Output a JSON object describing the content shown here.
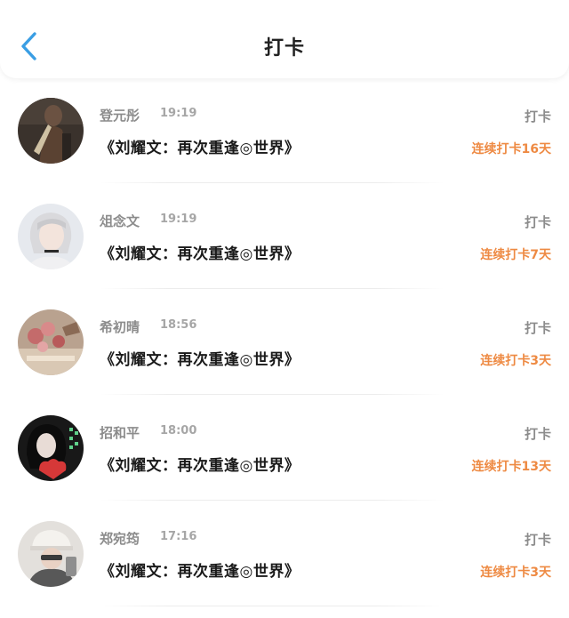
{
  "header": {
    "title": "打卡",
    "back_icon": "chevron-left-icon",
    "accent_color": "#3a9ee4"
  },
  "checkin_label": "打卡",
  "entries": [
    {
      "name": "登元彤",
      "time": "19:19",
      "book": "《刘耀文：再次重逢◎世界》",
      "streak": "连续打卡16天"
    },
    {
      "name": "俎念文",
      "time": "19:19",
      "book": "《刘耀文：再次重逢◎世界》",
      "streak": "连续打卡7天"
    },
    {
      "name": "希初晴",
      "time": "18:56",
      "book": "《刘耀文：再次重逢◎世界》",
      "streak": "连续打卡3天"
    },
    {
      "name": "招和平",
      "time": "18:00",
      "book": "《刘耀文：再次重逢◎世界》",
      "streak": "连续打卡13天"
    },
    {
      "name": "郑宛筠",
      "time": "17:16",
      "book": "《刘耀文：再次重逢◎世界》",
      "streak": "连续打卡3天"
    }
  ],
  "colors": {
    "streak": "#ee8a43",
    "meta": "#8c8c8c",
    "title_text": "#1a1a1a"
  }
}
